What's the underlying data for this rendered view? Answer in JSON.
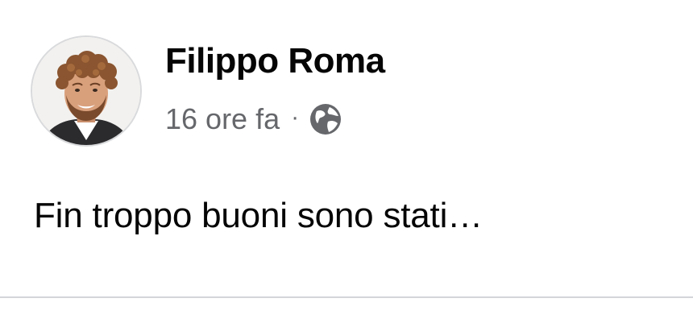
{
  "post": {
    "author": {
      "name": "Filippo Roma",
      "avatar_icon": "profile-photo"
    },
    "meta": {
      "timestamp": "16 ore fa",
      "separator": "·",
      "privacy_icon": "globe-icon"
    },
    "text": "Fin troppo buoni sono stati…"
  },
  "colors": {
    "primary_text": "#050505",
    "secondary_text": "#65676b",
    "divider": "#d3d5d9",
    "background": "#ffffff"
  }
}
